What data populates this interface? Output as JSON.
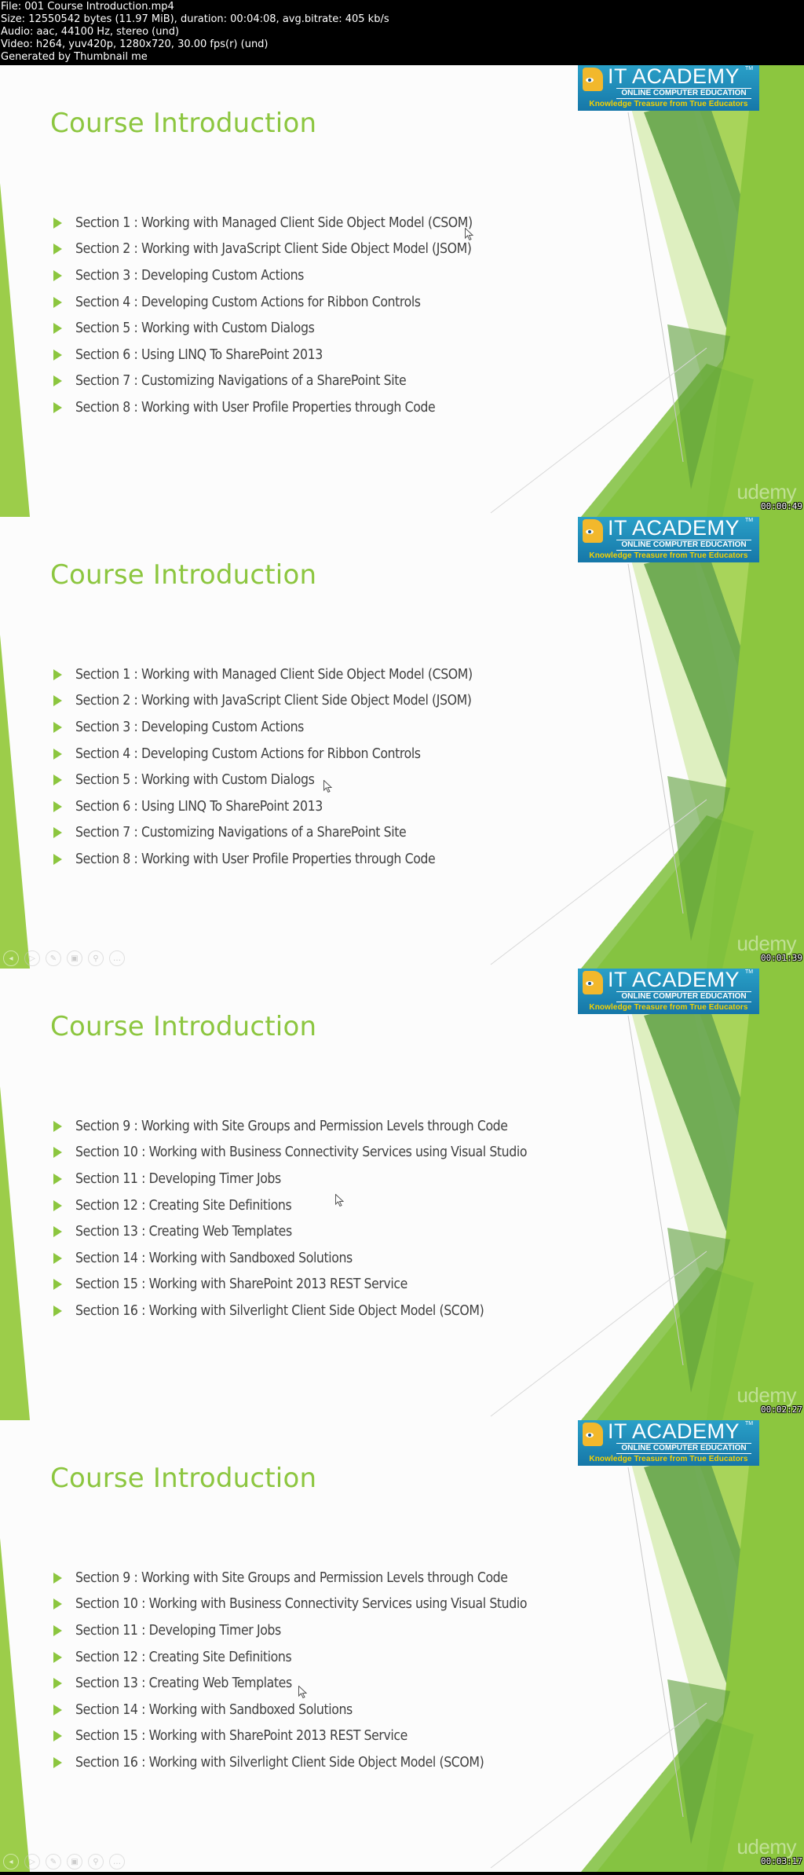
{
  "file_info": {
    "lines": [
      "File: 001 Course Introduction.mp4",
      "Size: 12550542 bytes (11.97 MiB), duration: 00:04:08, avg.bitrate: 405 kb/s",
      "Audio: aac, 44100 Hz, stereo (und)",
      "Video: h264, yuv420p, 1280x720, 30.00 fps(r) (und)",
      "Generated by Thumbnail me"
    ]
  },
  "logo": {
    "name": "IT ACADEMY",
    "tm": "TM",
    "subtitle": "ONLINE COMPUTER EDUCATION",
    "tagline": "Knowledge Treasure from True Educators"
  },
  "brand_watermark": "udemy",
  "colors": {
    "title_green": "#8cc63f",
    "body_text": "#404040",
    "logo_blue": "#1e8cbc",
    "tagline_yellow": "#f5d000"
  },
  "player_controls": [
    "previous-slide",
    "next-slide",
    "pen",
    "slides-grid",
    "zoom",
    "more-options"
  ],
  "frames": [
    {
      "title": "Course Introduction",
      "timestamp": "00:00:49",
      "show_controls": false,
      "bullets": [
        "Section 1 : Working with Managed Client Side Object Model (CSOM)",
        "Section 2 : Working with JavaScript Client Side Object Model (JSOM)",
        "Section 3 : Developing Custom Actions",
        "Section 4 : Developing Custom Actions for Ribbon Controls",
        "Section 5 : Working with Custom Dialogs",
        "Section 6 : Using LINQ To SharePoint 2013",
        "Section 7 : Customizing Navigations of a SharePoint Site",
        "Section 8 : Working with User Profile Properties through Code"
      ]
    },
    {
      "title": "Course Introduction",
      "timestamp": "00:01:39",
      "show_controls": true,
      "bullets": [
        "Section 1 : Working with Managed Client Side Object Model (CSOM)",
        "Section 2 : Working with JavaScript Client Side Object Model (JSOM)",
        "Section 3 : Developing Custom Actions",
        "Section 4 : Developing Custom Actions for Ribbon Controls",
        "Section 5 : Working with Custom Dialogs",
        "Section 6 : Using LINQ To SharePoint 2013",
        "Section 7 : Customizing Navigations of a SharePoint Site",
        "Section 8 : Working with User Profile Properties through Code"
      ]
    },
    {
      "title": "Course Introduction",
      "timestamp": "00:02:27",
      "show_controls": false,
      "bullets": [
        "Section 9 : Working with Site Groups and Permission Levels through Code",
        "Section 10 : Working with Business Connectivity Services using Visual Studio",
        "Section 11 : Developing Timer Jobs",
        "Section 12 : Creating Site Definitions",
        "Section 13 : Creating Web Templates",
        "Section 14 : Working with Sandboxed Solutions",
        "Section 15 : Working with SharePoint 2013 REST Service",
        "Section 16 : Working with Silverlight Client Side Object Model (SCOM)"
      ]
    },
    {
      "title": "Course Introduction",
      "timestamp": "00:03:17",
      "show_controls": true,
      "bullets": [
        "Section 9 : Working with Site Groups and Permission Levels through Code",
        "Section 10 : Working with Business Connectivity Services using Visual Studio",
        "Section 11 : Developing Timer Jobs",
        "Section 12 : Creating Site Definitions",
        "Section 13 : Creating Web Templates",
        "Section 14 : Working with Sandboxed Solutions",
        "Section 15 : Working with SharePoint 2013 REST Service",
        "Section 16 : Working with Silverlight Client Side Object Model (SCOM)"
      ]
    }
  ]
}
